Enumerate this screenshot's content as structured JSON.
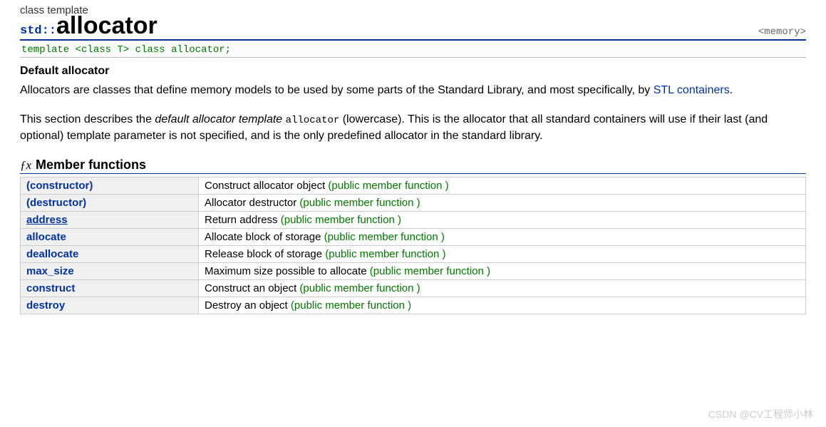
{
  "pretitle": "class template",
  "ns": "std::",
  "cls": "allocator",
  "header": "<memory>",
  "signature": "template <class T> class allocator;",
  "subheading": "Default allocator",
  "para1_a": "Allocators are classes that define memory models to be used by some parts of the Standard Library, and most specifically, by ",
  "para1_link": "STL containers",
  "para1_b": ".",
  "para2_a": "This section describes the ",
  "para2_em": "default allocator template",
  "para2_b": " ",
  "para2_code": "allocator",
  "para2_c": " (lowercase). This is the allocator that all standard containers will use if their last (and optional) template parameter is not specified, and is the only predefined allocator in the standard library.",
  "section_fx": "ƒx",
  "section_title": "Member functions",
  "pubtag": "(public member function )",
  "rows": [
    {
      "name": "(constructor)",
      "ul": false,
      "desc": "Construct allocator object "
    },
    {
      "name": "(destructor)",
      "ul": false,
      "desc": "Allocator destructor "
    },
    {
      "name": "address",
      "ul": true,
      "desc": "Return address "
    },
    {
      "name": "allocate",
      "ul": false,
      "desc": "Allocate block of storage "
    },
    {
      "name": "deallocate",
      "ul": false,
      "desc": "Release block of storage "
    },
    {
      "name": "max_size",
      "ul": false,
      "desc": "Maximum size possible to allocate "
    },
    {
      "name": "construct",
      "ul": false,
      "desc": "Construct an object "
    },
    {
      "name": "destroy",
      "ul": false,
      "desc": "Destroy an object "
    }
  ],
  "watermark": "CSDN @CV工程师小林"
}
